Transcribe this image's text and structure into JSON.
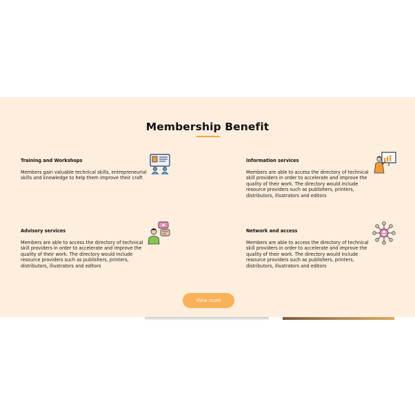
{
  "section": {
    "title": "Membership Benefit",
    "accent_color": "#f4a73e",
    "background_color": "#fdeedd"
  },
  "cards": [
    {
      "title": "Training and Workshops",
      "text": "Members gain valuable technical skills, entrepreneurial skills and knowledge to help them improve their craft",
      "icon": "training-presentation-icon"
    },
    {
      "title": "Information services",
      "text": "Members are able to access the directory of technical skill providers in order to accelerate and improve the quality of their work. The directory would include resource providers such as publishers, printers, distributors, illustrators and editors",
      "icon": "presenter-chart-icon"
    },
    {
      "title": "Advisory services",
      "text": "Members are able to access the directory of technical skill providers in order to accelerate and improve the quality of their work. The directory would include resource providers such as publishers, printers, distributors, illustrators and editors",
      "icon": "advisor-chat-icon"
    },
    {
      "title": "Network and access",
      "text": "Members are able to access the directory of technical skill providers in order to accelerate and improve the quality of their work. The directory would include resource providers such as publishers, printers, distributors, illustrators and editors",
      "icon": "network-people-icon"
    }
  ],
  "actions": {
    "view_more_label": "View more",
    "button_color": "#f7b25a"
  }
}
